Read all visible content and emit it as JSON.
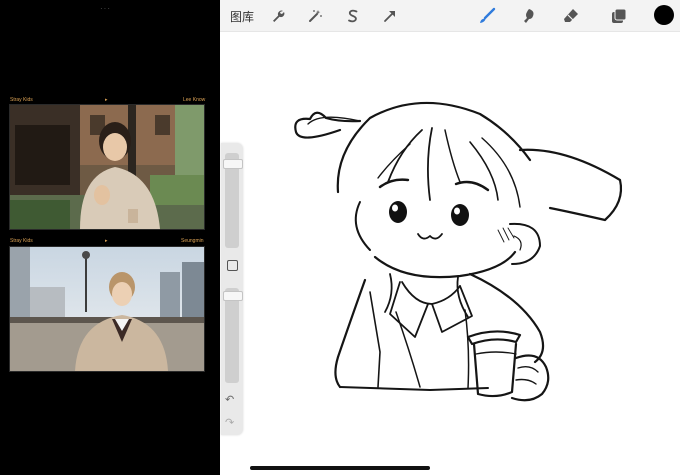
{
  "app": {
    "gallery_label": "图库",
    "tools": [
      {
        "name": "actions-wrench-icon"
      },
      {
        "name": "adjustments-wand-icon"
      },
      {
        "name": "selection-s-icon"
      },
      {
        "name": "transform-arrow-icon"
      },
      {
        "name": "brush-icon"
      },
      {
        "name": "smudge-icon"
      },
      {
        "name": "eraser-icon"
      },
      {
        "name": "layers-icon"
      }
    ],
    "current_color": "#000000",
    "accent": "#2f7bdc"
  },
  "reference": {
    "top_dots": "···",
    "photos": [
      {
        "left_label": "Stray Kids",
        "right_label": "Lee Know"
      },
      {
        "left_label": "Stray Kids",
        "right_label": "Seungmin"
      }
    ]
  },
  "sidebar": {
    "undo_icon": "↶",
    "redo_icon": "↷"
  }
}
